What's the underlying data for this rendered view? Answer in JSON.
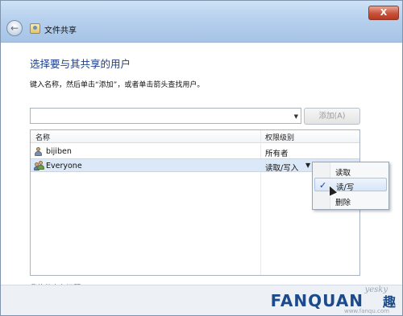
{
  "window": {
    "title": "文件共享",
    "close_glyph": "X",
    "back_glyph": "←"
  },
  "main": {
    "heading": "选择要与其共享的用户",
    "instruction": "键入名称，然后单击“添加”，或者单击箭头查找用户。",
    "add_button": "添加(A)",
    "table": {
      "headers": [
        "名称",
        "权限级别"
      ],
      "rows": [
        {
          "name": "bijiben",
          "permission": "所有者",
          "icon": "user-icon",
          "selected": false
        },
        {
          "name": "Everyone",
          "permission": "读取/写入",
          "icon": "group-icon",
          "selected": true
        }
      ]
    },
    "permission_menu": {
      "items": [
        {
          "label": "读取",
          "checked": false
        },
        {
          "label": "读/写",
          "checked": true
        },
        {
          "label": "删除",
          "checked": false
        }
      ],
      "check_glyph": "✓"
    },
    "problem_link": "我的共享有问题"
  },
  "watermark": {
    "top": "yesky",
    "main": "FANQUAN",
    "cn": "趣",
    "url": "www.fanqu.com"
  },
  "colors": {
    "heading": "#1e3f8e",
    "link": "#1c53a8",
    "selection": "#dbe8f7"
  }
}
